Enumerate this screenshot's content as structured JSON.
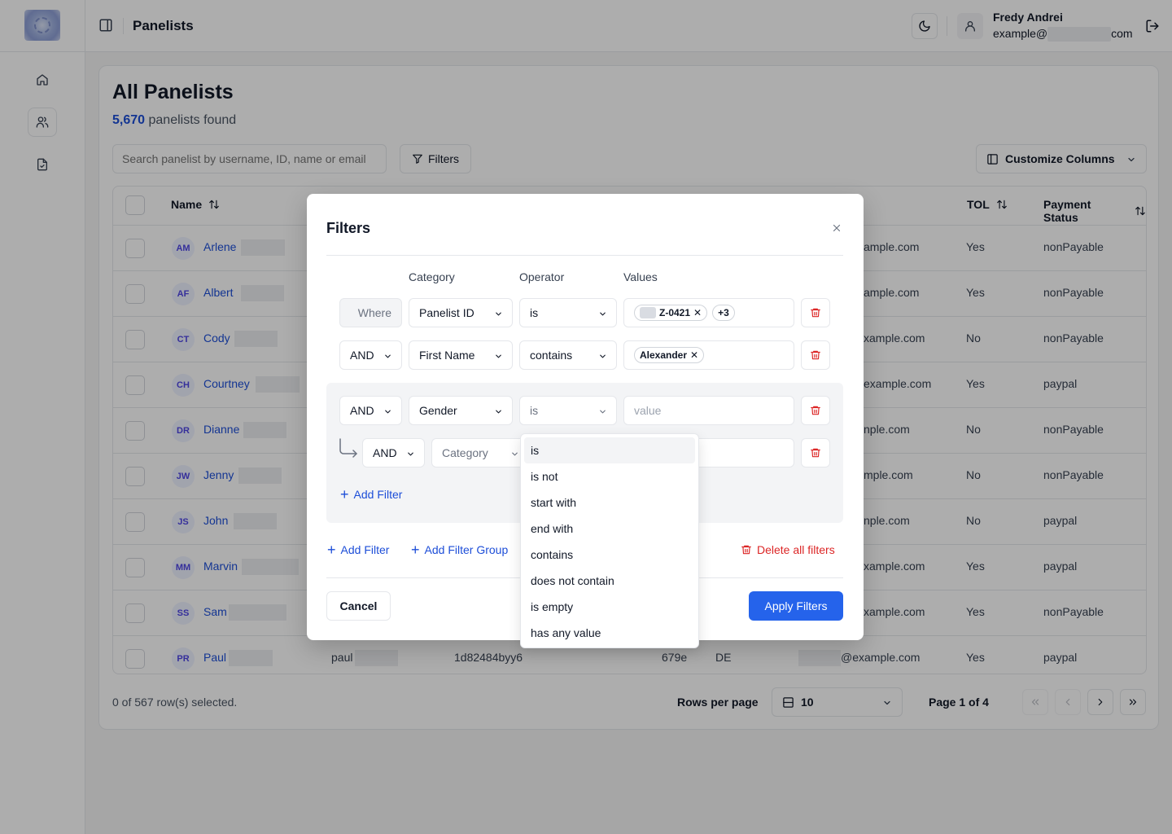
{
  "header": {
    "title": "Panelists",
    "user_name": "Fredy Andrei",
    "email_prefix": "example@",
    "email_suffix": "com"
  },
  "main": {
    "title": "All Panelists",
    "count": "5,670",
    "count_suffix": "panelists found",
    "search_placeholder": "Search panelist by username, ID, name or email",
    "filters_label": "Filters",
    "customize_label": "Customize Columns"
  },
  "table": {
    "columns": {
      "name": "Name",
      "tol": "TOL",
      "payment": "Payment Status"
    },
    "rows": [
      {
        "initials": "AM",
        "name": "Arlene",
        "email": "ample.com",
        "tol": "Yes",
        "payment": "nonPayable"
      },
      {
        "initials": "AF",
        "name": "Albert",
        "email": "ample.com",
        "tol": "Yes",
        "payment": "nonPayable"
      },
      {
        "initials": "CT",
        "name": "Cody",
        "email": "xample.com",
        "tol": "No",
        "payment": "nonPayable"
      },
      {
        "initials": "CH",
        "name": "Courtney",
        "email": "example.com",
        "tol": "Yes",
        "payment": "paypal"
      },
      {
        "initials": "DR",
        "name": "Dianne",
        "email": "nple.com",
        "tol": "No",
        "payment": "nonPayable"
      },
      {
        "initials": "JW",
        "name": "Jenny",
        "email": "mple.com",
        "tol": "No",
        "payment": "nonPayable"
      },
      {
        "initials": "JS",
        "name": "John",
        "email": "nple.com",
        "tol": "No",
        "payment": "paypal"
      },
      {
        "initials": "MM",
        "name": "Marvin",
        "email": "xample.com",
        "tol": "Yes",
        "payment": "paypal"
      },
      {
        "initials": "SS",
        "name": "Sam",
        "email": "xample.com",
        "tol": "Yes",
        "payment": "nonPayable"
      },
      {
        "initials": "PR",
        "name": "Paul",
        "username": "paul",
        "id": "1d82484byy6",
        "id_tail": "679e",
        "country": "DE",
        "email": "@example.com",
        "tol": "Yes",
        "payment": "paypal"
      }
    ],
    "selection": "0 of 567 row(s) selected.",
    "rows_per_page_label": "Rows per page",
    "rows_per_page": "10",
    "page_info": "Page 1 of 4"
  },
  "modal": {
    "title": "Filters",
    "col_category": "Category",
    "col_operator": "Operator",
    "col_values": "Values",
    "rows": [
      {
        "conj": "Where",
        "category": "Panelist ID",
        "operator": "is",
        "chip": "Z-0421",
        "more": "+3"
      },
      {
        "conj": "AND",
        "category": "First Name",
        "operator": "contains",
        "chip": "Alexander"
      },
      {
        "conj": "AND",
        "category": "Gender",
        "operator": "is",
        "value_placeholder": "value"
      },
      {
        "conj": "AND",
        "category_placeholder": "Category"
      }
    ],
    "add_filter_inner": "Add Filter",
    "add_filter": "Add Filter",
    "add_filter_group": "Add Filter Group",
    "delete_all": "Delete all filters",
    "cancel": "Cancel",
    "apply": "Apply Filters"
  },
  "operator_dropdown": [
    "is",
    "is not",
    "start with",
    "end with",
    "contains",
    "does not contain",
    "is empty",
    "has any value"
  ],
  "colors": {
    "accent": "#2563eb",
    "link": "#1d4ed8",
    "danger": "#dc2626"
  }
}
